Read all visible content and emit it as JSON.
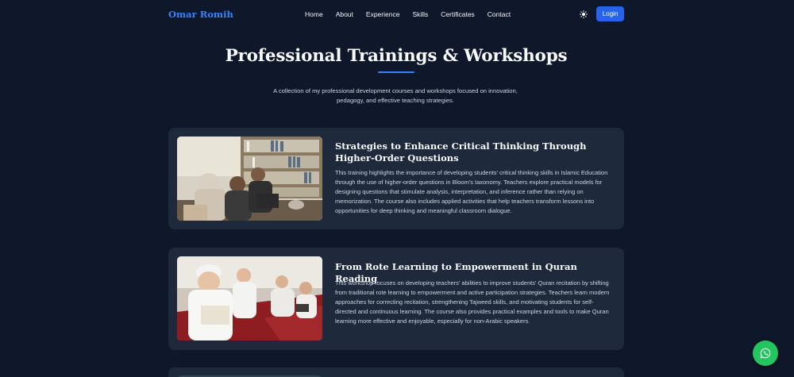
{
  "nav": {
    "brand": "Omar Romih",
    "items": [
      "Home",
      "About",
      "Experience",
      "Skills",
      "Certificates",
      "Contact"
    ],
    "login_label": "Login",
    "theme_icon": "sun-icon"
  },
  "header": {
    "title": "Professional Trainings & Workshops",
    "subtitle": "A collection of my professional development courses and workshops focused on innovation, pedagogy, and effective teaching strategies."
  },
  "cards": [
    {
      "title": "Strategies to Enhance Critical Thinking Through Higher-Order Questions",
      "description": "This training highlights the importance of developing students' critical thinking skills in Islamic Education through the use of higher-order questions in Bloom's taxonomy. Teachers explore practical models for designing questions that stimulate analysis, interpretation, and inference rather than relying on memorization. The course also includes applied activities that help teachers transform lessons into opportunities for deep thinking and meaningful classroom dialogue."
    },
    {
      "title": "From Rote Learning to Empowerment in Quran Reading",
      "description": "This workshop focuses on developing teachers' abilities to improve students' Quran recitation by shifting from traditional rote learning to empowerment and active participation strategies. Teachers learn modern approaches for correcting recitation, strengthening Tajweed skills, and motivating students for self-directed and continuous learning. The course also provides practical examples and tools to make Quran learning more effective and enjoyable, especially for non-Arabic speakers."
    }
  ],
  "colors": {
    "background": "#0f172a",
    "card": "#1e293b",
    "accent": "#3b82f6",
    "whatsapp": "#22c55e"
  },
  "floating": {
    "icon": "whatsapp-icon"
  }
}
